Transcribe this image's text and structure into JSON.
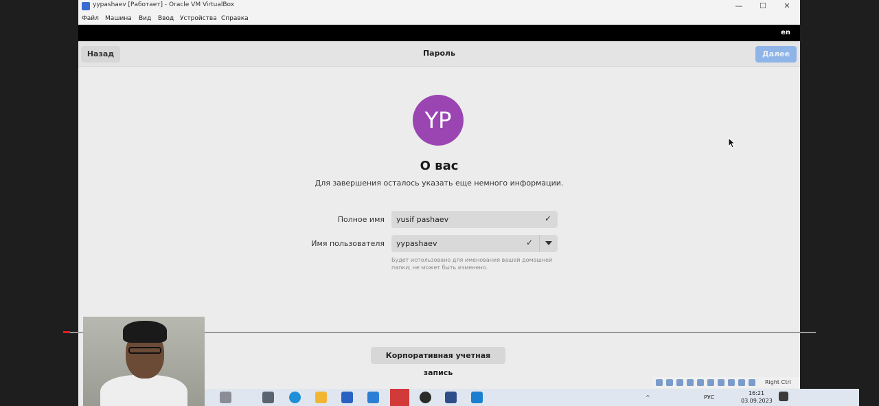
{
  "vbox": {
    "title": "yypashaev [Работает] - Oracle VM VirtualBox",
    "menu": [
      "Файл",
      "Машина",
      "Вид",
      "Ввод",
      "Устройства",
      "Справка"
    ],
    "controls": {
      "minimize": "—",
      "maximize": "☐",
      "close": "✕"
    }
  },
  "guest": {
    "lang": "en",
    "header": {
      "back": "Назад",
      "title": "Пароль",
      "next": "Далее"
    },
    "avatar_initials": "YP",
    "heading": "О вас",
    "subtitle": "Для завершения осталось указать еще немного информации.",
    "fields": {
      "full_name_label": "Полное имя",
      "full_name_value": "yusif pashaev",
      "username_label": "Имя пользователя",
      "username_value": "yypashaev",
      "hint": "Будет использовано для именования вашей домашней папки; не может быть изменено."
    },
    "enterprise_login": "Корпоративная учетная запись"
  },
  "statusbar": {
    "host_key": "Right Ctrl"
  },
  "taskbar": {
    "lang": "РУС",
    "time": "16:21",
    "date": "03.09.2023"
  },
  "colors": {
    "avatar": "#9b45b3",
    "next_button": "#8fb4e8"
  }
}
